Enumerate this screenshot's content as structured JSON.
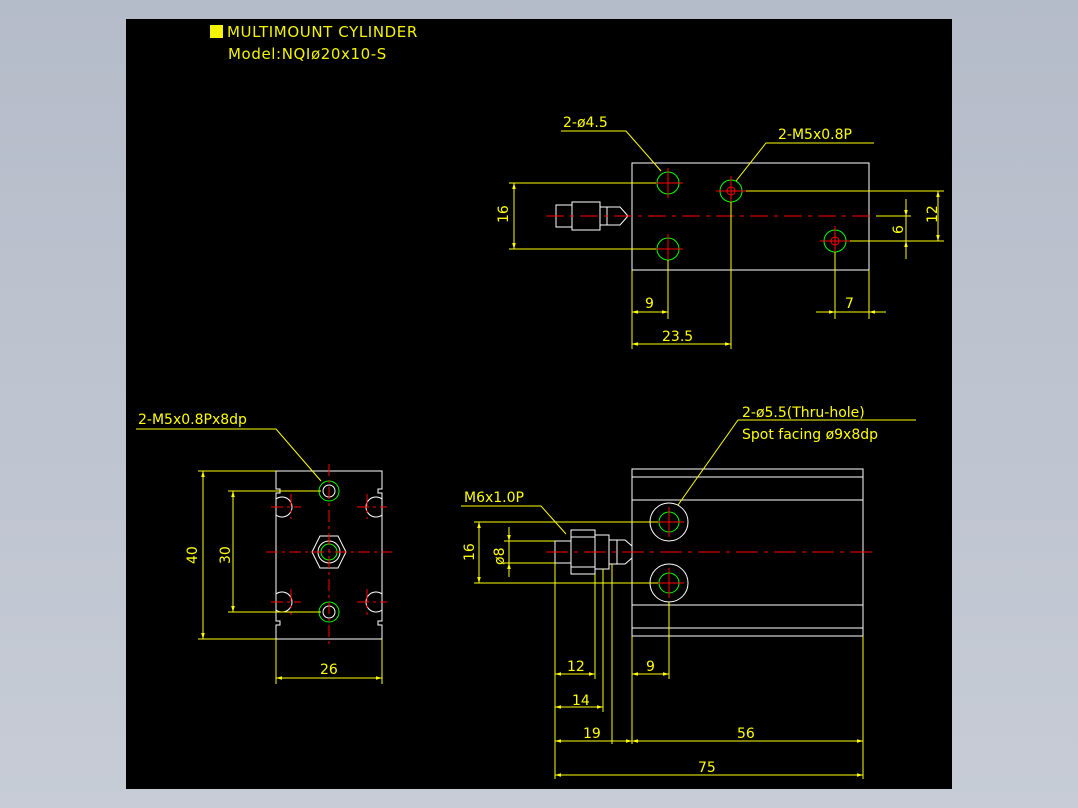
{
  "title": {
    "heading": "MULTIMOUNT CYLINDER",
    "model": "Model:NQIø20x10-S"
  },
  "colors": {
    "background": "#000000",
    "dimension": "#ffff00",
    "outline": "#ffffff",
    "centerline": "#ff0000",
    "hole": "#00ff00"
  },
  "top_view": {
    "callout_holes": "2-ø4.5",
    "callout_thread": "2-M5x0.8P",
    "dim_height_left": "16",
    "dim_right_outer": "12",
    "dim_right_inner": "6",
    "dim_bottom_9": "9",
    "dim_bottom_23_5": "23.5",
    "dim_bottom_7": "7"
  },
  "end_view": {
    "callout_thread": "2-M5x0.8Px8dp",
    "dim_height_40": "40",
    "dim_height_30": "30",
    "dim_width_26": "26"
  },
  "side_view": {
    "callout_holes_line1": "2-ø5.5(Thru-hole)",
    "callout_holes_line2": "Spot facing ø9x8dp",
    "callout_rod_thread": "M6x1.0P",
    "dim_height_16": "16",
    "dim_rod_dia": "ø8",
    "dim_12": "12",
    "dim_9": "9",
    "dim_14": "14",
    "dim_19": "19",
    "dim_56": "56",
    "dim_75": "75"
  }
}
